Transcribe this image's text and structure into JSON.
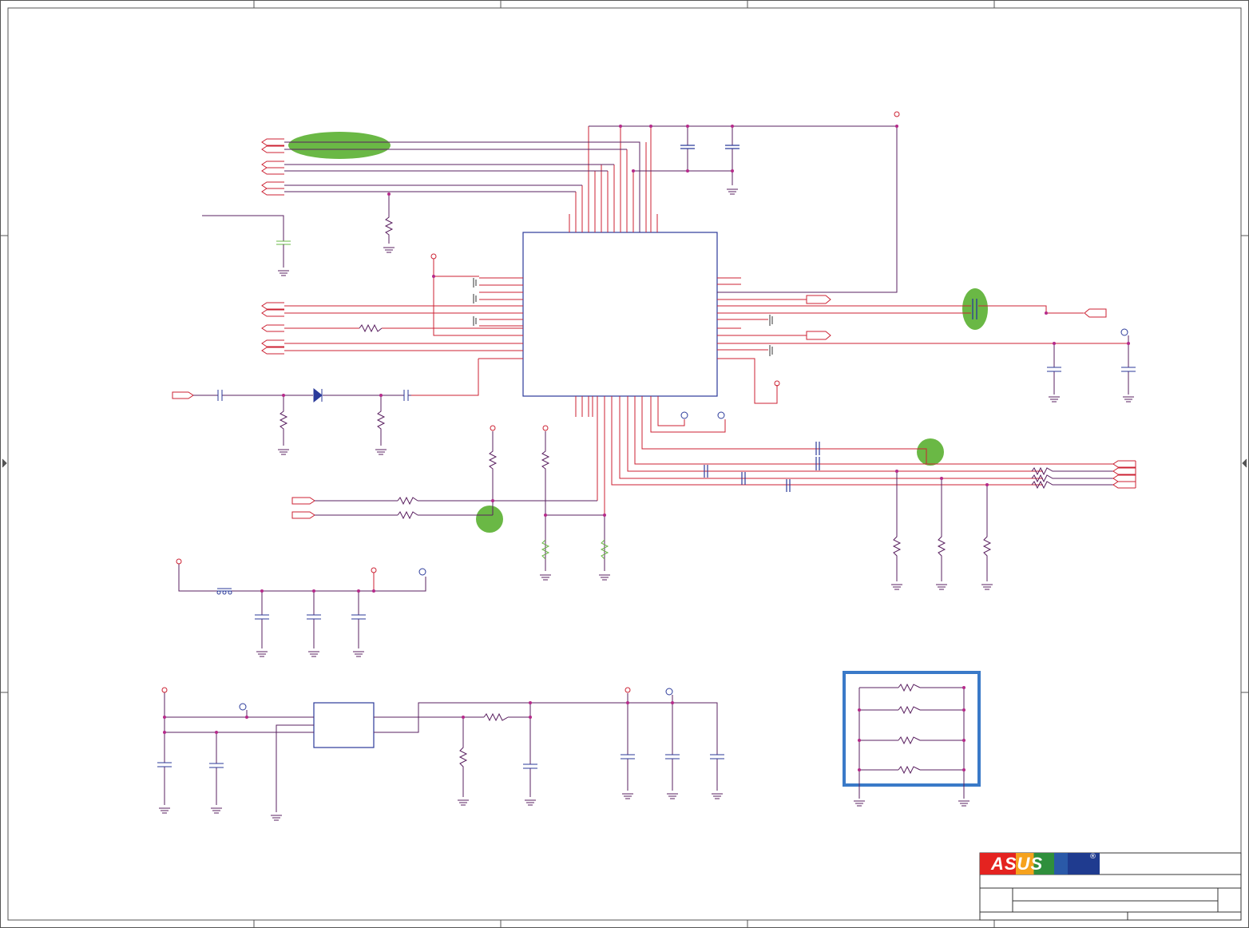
{
  "logo": {
    "text": "ASUS",
    "registered_mark": "®"
  },
  "colors": {
    "border": "#555555",
    "wire_red": "#cc2233",
    "wire_purple": "#5a2060",
    "component_blue": "#2b3a9a",
    "marker_green": "#6ab845",
    "highlight_box": "#3a7ac8",
    "junction": "#b52a8a"
  }
}
